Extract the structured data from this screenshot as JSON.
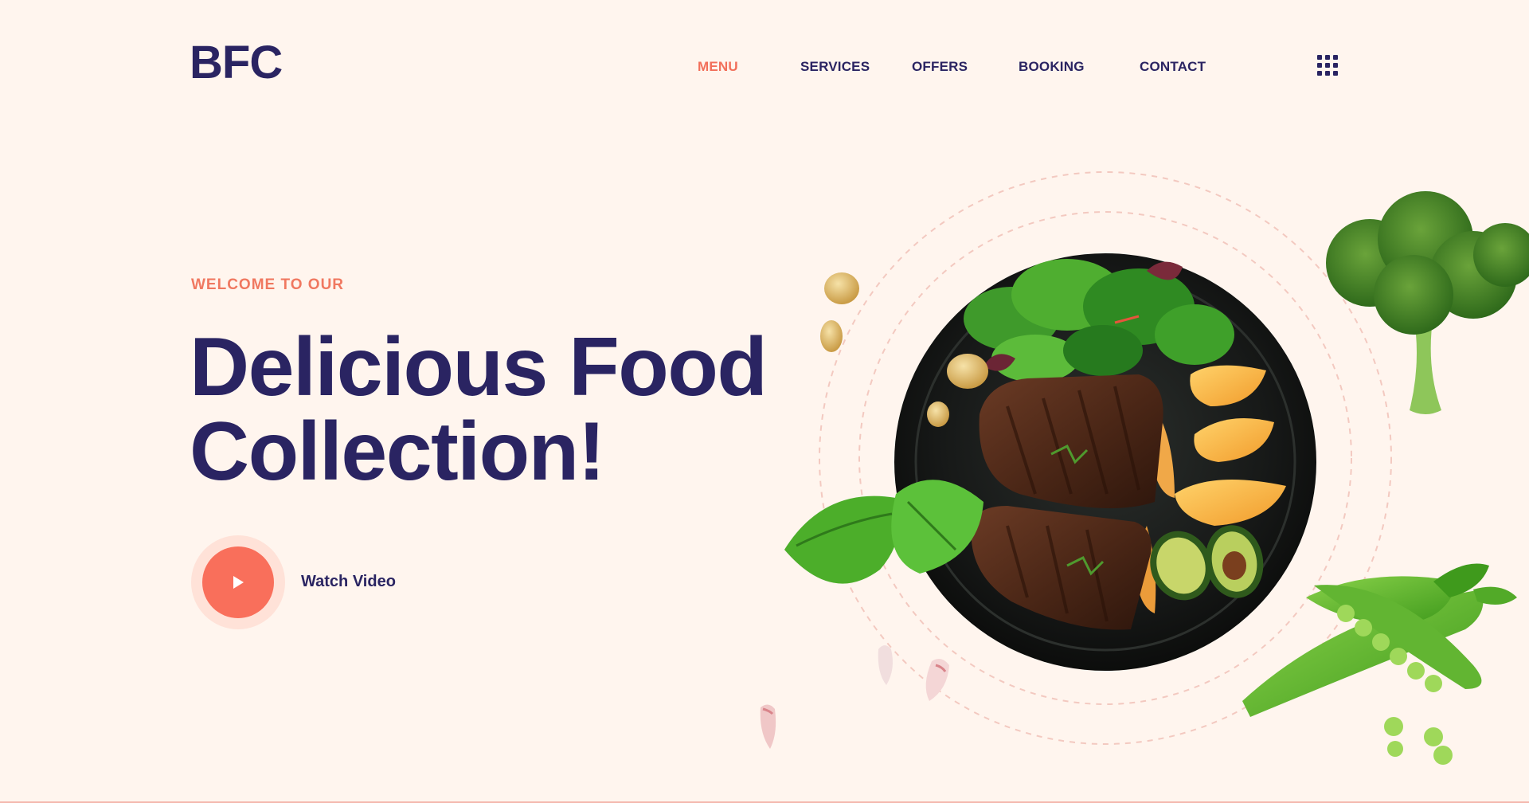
{
  "brand": {
    "logo": "BFC"
  },
  "nav": {
    "items": [
      {
        "label": "MENU",
        "active": true
      },
      {
        "label": "SERVICES",
        "active": false
      },
      {
        "label": "OFFERS",
        "active": false
      },
      {
        "label": "BOOKING",
        "active": false
      },
      {
        "label": "CONTACT",
        "active": false
      }
    ],
    "menu_icon": "grid-menu-icon"
  },
  "hero": {
    "eyebrow": "WELCOME TO OUR",
    "headline_line1": "Delicious Food",
    "headline_line2": "Collection!",
    "watch_label": "Watch Video",
    "play_icon": "play-icon"
  },
  "colors": {
    "background": "#fff5ee",
    "primary_text": "#2a2462",
    "accent": "#f96f5b",
    "accent_soft": "#ffe2d8"
  },
  "imagery": {
    "main_dish": "plate-steak-salad-image",
    "decor": [
      "broccoli-image",
      "peas-image",
      "basil-leaf-image",
      "nuts-image",
      "garlic-image"
    ]
  }
}
